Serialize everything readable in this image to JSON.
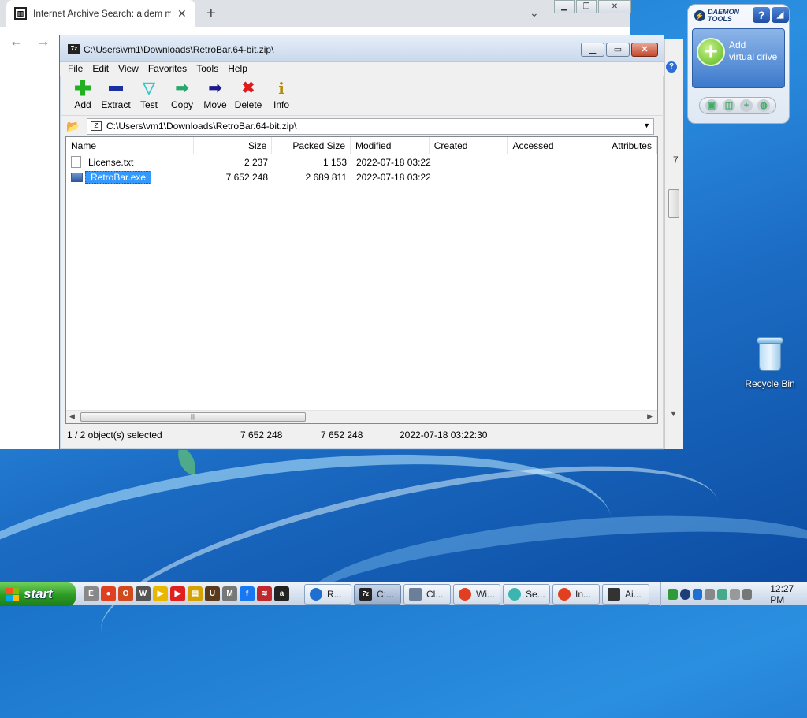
{
  "browser": {
    "tab_title": "Internet Archive Search: aidem m",
    "tab_close": "✕",
    "new_tab": "+",
    "caret": "⌄",
    "back": "←",
    "forward": "→",
    "favicon": "archive-icon"
  },
  "zip": {
    "title": "C:\\Users\\vm1\\Downloads\\RetroBar.64-bit.zip\\",
    "app_icon_text": "7z",
    "menu": [
      "File",
      "Edit",
      "View",
      "Favorites",
      "Tools",
      "Help"
    ],
    "toolbar": [
      {
        "label": "Add",
        "glyph": "✚"
      },
      {
        "label": "Extract",
        "glyph": ""
      },
      {
        "label": "Test",
        "glyph": "▽"
      },
      {
        "label": "Copy",
        "glyph": "➡"
      },
      {
        "label": "Move",
        "glyph": "➡"
      },
      {
        "label": "Delete",
        "glyph": "✖"
      },
      {
        "label": "Info",
        "glyph": "i"
      }
    ],
    "path": "C:\\Users\\vm1\\Downloads\\RetroBar.64-bit.zip\\",
    "columns": [
      "Name",
      "Size",
      "Packed Size",
      "Modified",
      "Created",
      "Accessed",
      "Attributes"
    ],
    "rows": [
      {
        "name": "License.txt",
        "size": "2 237",
        "packed": "1 153",
        "modified": "2022-07-18 03:22",
        "selected": false
      },
      {
        "name": "RetroBar.exe",
        "size": "7 652 248",
        "packed": "2 689 811",
        "modified": "2022-07-18 03:22",
        "selected": true
      }
    ],
    "status": {
      "selection": "1 / 2 object(s) selected",
      "size": "7 652 248",
      "packed": "7 652 248",
      "modified": "2022-07-18 03:22:30"
    }
  },
  "side_strip": {
    "text": "7"
  },
  "daemon": {
    "brand_line1": "DAEMON",
    "brand_line2": "TOOLS",
    "help": "?",
    "panel_line1": "Add",
    "panel_line2": "virtual drive"
  },
  "desktop": {
    "recycle_bin": "Recycle Bin"
  },
  "taskbar": {
    "start_label": "start",
    "tasks": [
      {
        "label": "R...",
        "color": "#1e6fd0"
      },
      {
        "label": "C:...",
        "color": "#222222"
      },
      {
        "label": "Cl...",
        "color": "#6b7f99"
      },
      {
        "label": "Wi...",
        "color": "#e0401f"
      },
      {
        "label": "Se...",
        "color": "#3ab5b0"
      },
      {
        "label": "In...",
        "color": "#e0401f"
      },
      {
        "label": "Ai...",
        "color": "#333333"
      }
    ],
    "clock": "12:27 PM"
  }
}
